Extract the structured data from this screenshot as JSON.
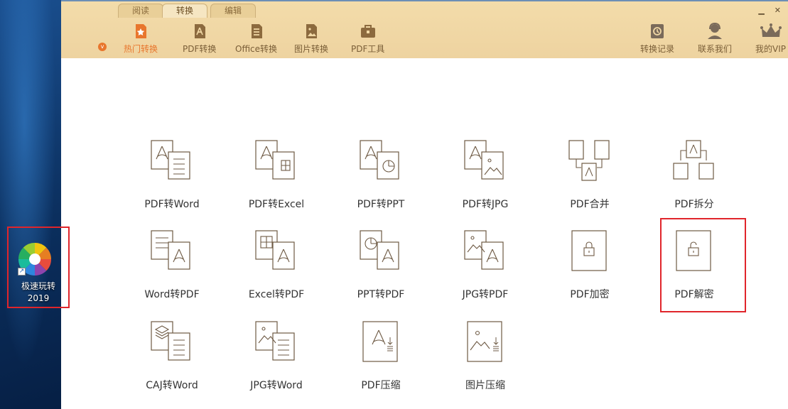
{
  "desktop": {
    "shortcut_label_line1": "极速玩转",
    "shortcut_label_line2": "2019",
    "highlight_color": "#e0252b"
  },
  "window": {
    "tabs": [
      {
        "label": "阅读",
        "active": false
      },
      {
        "label": "转换",
        "active": true
      },
      {
        "label": "编辑",
        "active": false
      }
    ],
    "controls": {
      "minimize": "▁",
      "close": "✕"
    },
    "nav_left": [
      {
        "label": "热门转换",
        "icon": "star-icon",
        "active": true
      },
      {
        "label": "PDF转换",
        "icon": "pdf-file-icon",
        "active": false
      },
      {
        "label": "Office转换",
        "icon": "document-icon",
        "active": false
      },
      {
        "label": "图片转换",
        "icon": "image-icon",
        "active": false
      },
      {
        "label": "PDF工具",
        "icon": "toolbox-icon",
        "active": false
      }
    ],
    "hot_badge": "v",
    "nav_right": [
      {
        "label": "转换记录",
        "icon": "history-icon"
      },
      {
        "label": "联系我们",
        "icon": "support-icon"
      },
      {
        "label": "我的VIP",
        "icon": "crown-icon"
      }
    ],
    "accent_color": "#e8762d",
    "toolbar_color": "#f1d8a5"
  },
  "tools": [
    {
      "label": "PDF转Word",
      "icon": "pdf-to-word-icon"
    },
    {
      "label": "PDF转Excel",
      "icon": "pdf-to-excel-icon"
    },
    {
      "label": "PDF转PPT",
      "icon": "pdf-to-ppt-icon"
    },
    {
      "label": "PDF转JPG",
      "icon": "pdf-to-jpg-icon"
    },
    {
      "label": "PDF合并",
      "icon": "pdf-merge-icon"
    },
    {
      "label": "PDF拆分",
      "icon": "pdf-split-icon"
    },
    {
      "label": "Word转PDF",
      "icon": "word-to-pdf-icon"
    },
    {
      "label": "Excel转PDF",
      "icon": "excel-to-pdf-icon"
    },
    {
      "label": "PPT转PDF",
      "icon": "ppt-to-pdf-icon"
    },
    {
      "label": "JPG转PDF",
      "icon": "jpg-to-pdf-icon"
    },
    {
      "label": "PDF加密",
      "icon": "pdf-encrypt-icon"
    },
    {
      "label": "PDF解密",
      "icon": "pdf-decrypt-icon",
      "highlighted": true
    },
    {
      "label": "CAJ转Word",
      "icon": "caj-to-word-icon"
    },
    {
      "label": "JPG转Word",
      "icon": "jpg-to-word-icon"
    },
    {
      "label": "PDF压缩",
      "icon": "pdf-compress-icon"
    },
    {
      "label": "图片压缩",
      "icon": "image-compress-icon"
    }
  ]
}
